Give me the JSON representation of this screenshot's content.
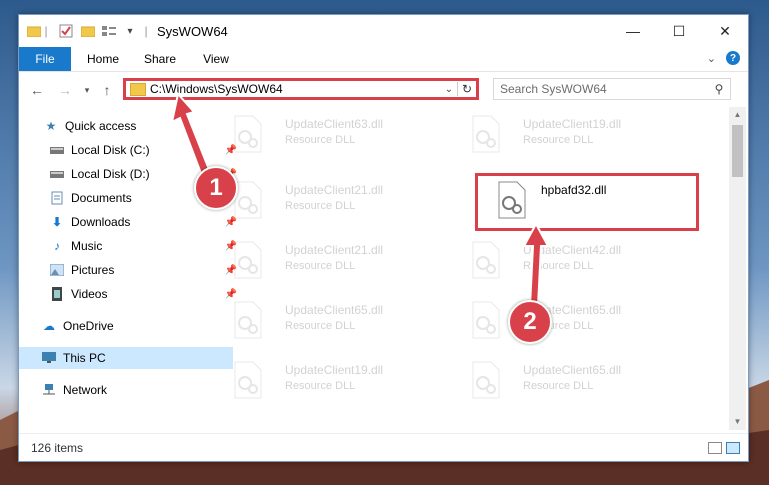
{
  "window": {
    "title": "SysWOW64",
    "controls": {
      "minimize": "—",
      "maximize": "☐",
      "close": "✕"
    }
  },
  "ribbon": {
    "tabs": [
      "File",
      "Home",
      "Share",
      "View"
    ]
  },
  "address": {
    "path": "C:\\Windows\\SysWOW64"
  },
  "search": {
    "placeholder": "Search SysWOW64"
  },
  "sidebar": {
    "items": [
      {
        "label": "Quick access",
        "icon": "star-icon",
        "pinned": false
      },
      {
        "label": "Local Disk (C:)",
        "icon": "drive-icon",
        "pinned": true
      },
      {
        "label": "Local Disk (D:)",
        "icon": "drive-icon",
        "pinned": true
      },
      {
        "label": "Documents",
        "icon": "documents-icon",
        "pinned": true
      },
      {
        "label": "Downloads",
        "icon": "downloads-icon",
        "pinned": true
      },
      {
        "label": "Music",
        "icon": "music-icon",
        "pinned": true
      },
      {
        "label": "Pictures",
        "icon": "pictures-icon",
        "pinned": true
      },
      {
        "label": "Videos",
        "icon": "videos-icon",
        "pinned": true
      },
      {
        "label": "OneDrive",
        "icon": "onedrive-icon",
        "pinned": false
      },
      {
        "label": "This PC",
        "icon": "pc-icon",
        "pinned": false,
        "selected": true
      },
      {
        "label": "Network",
        "icon": "network-icon",
        "pinned": false
      }
    ]
  },
  "files": [
    {
      "name": "UpdateClient63.dll",
      "type": "Resource DLL"
    },
    {
      "name": "UpdateClient19.dll",
      "type": "Resource DLL"
    },
    {
      "name": "UpdateClient21.dll",
      "type": "Resource DLL"
    },
    {
      "name": "hpbafd32.dll",
      "type": ""
    },
    {
      "name": "UpdateClient21.dll",
      "type": "Resource DLL"
    },
    {
      "name": "UpdateClient42.dll",
      "type": "Resource DLL"
    },
    {
      "name": "UpdateClient65.dll",
      "type": "Resource DLL"
    },
    {
      "name": "UpdateClient65.dll",
      "type": "Resource DLL"
    },
    {
      "name": "UpdateClient19.dll",
      "type": "Resource DLL"
    },
    {
      "name": "UpdateClient65.dll",
      "type": "Resource DLL"
    }
  ],
  "status": {
    "item_count": "126 items"
  },
  "annotations": {
    "step1": "1",
    "step2": "2"
  },
  "colors": {
    "accent": "#1979ca",
    "highlight": "#d9414a",
    "selected": "#cce8ff"
  }
}
